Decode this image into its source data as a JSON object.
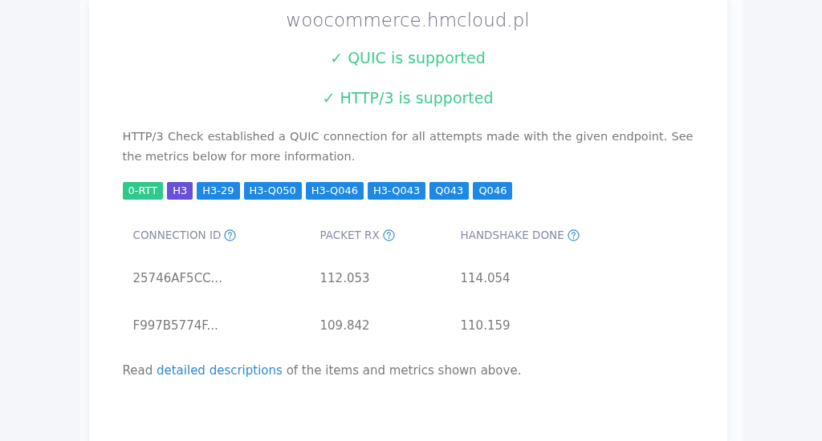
{
  "domain": "woocommerce.hmcloud.pl",
  "checks": [
    {
      "label": "✓ QUIC is supported"
    },
    {
      "label": "✓ HTTP/3 is supported"
    }
  ],
  "summary": "HTTP/3 Check established a QUIC connection for all attempts made with the given endpoint. See the metrics below for more information.",
  "badges": [
    {
      "label": "0-RTT",
      "color": "#2fc98c"
    },
    {
      "label": "H3",
      "color": "#6a4fd8"
    },
    {
      "label": "H3-29",
      "color": "#1e88e5"
    },
    {
      "label": "H3-Q050",
      "color": "#1e88e5"
    },
    {
      "label": "H3-Q046",
      "color": "#1e88e5"
    },
    {
      "label": "H3-Q043",
      "color": "#1e88e5"
    },
    {
      "label": "Q043",
      "color": "#1e88e5"
    },
    {
      "label": "Q046",
      "color": "#1e88e5"
    }
  ],
  "table": {
    "columns": [
      "CONNECTION ID",
      "PACKET RX",
      "HANDSHAKE DONE"
    ],
    "rows": [
      [
        "25746AF5CC...",
        "112.053",
        "114.054"
      ],
      [
        "F997B5774F...",
        "109.842",
        "110.159"
      ]
    ]
  },
  "footer": {
    "before": "Read ",
    "link": "detailed descriptions",
    "after": " of the items and metrics shown above."
  }
}
